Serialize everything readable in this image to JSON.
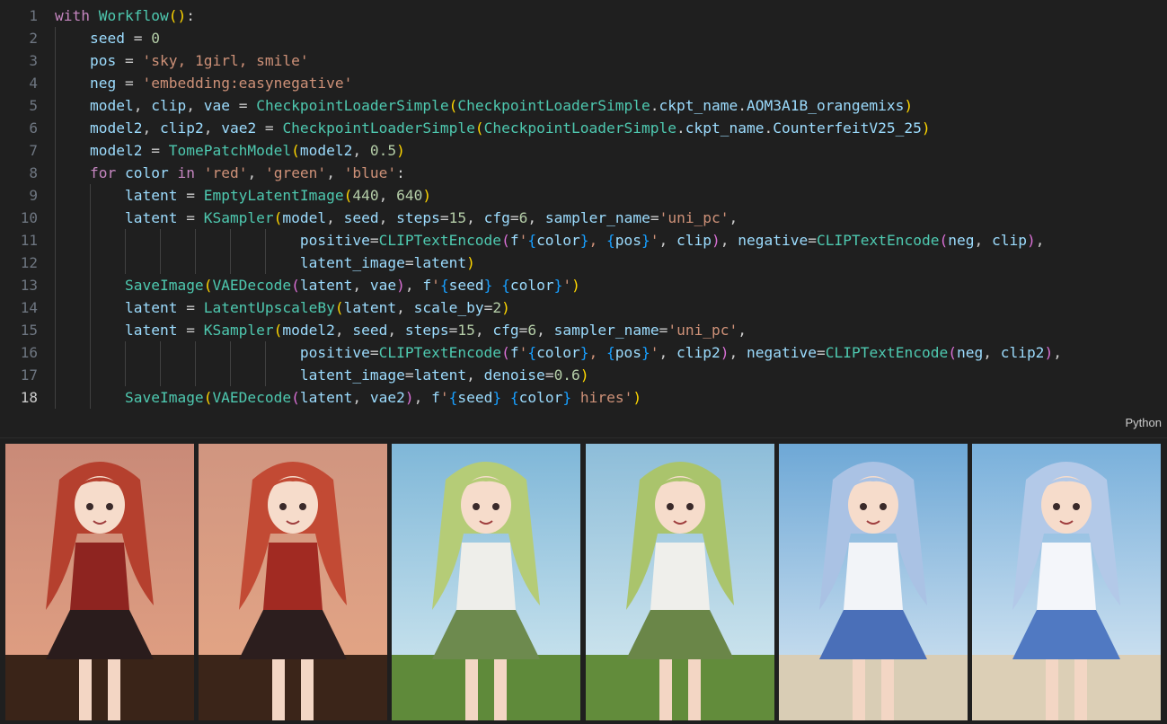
{
  "editor": {
    "language": "Python",
    "active_line": "18",
    "lines": [
      {
        "n": "1",
        "tokens": [
          [
            "k",
            "with"
          ],
          [
            "p",
            " "
          ],
          [
            "c",
            "Workflow"
          ],
          [
            "b1",
            "()"
          ],
          [
            "p",
            ":"
          ]
        ]
      },
      {
        "n": "2",
        "tokens": [
          [
            "p",
            "    "
          ],
          [
            "v",
            "seed"
          ],
          [
            "p",
            " = "
          ],
          [
            "n",
            "0"
          ]
        ]
      },
      {
        "n": "3",
        "tokens": [
          [
            "p",
            "    "
          ],
          [
            "v",
            "pos"
          ],
          [
            "p",
            " = "
          ],
          [
            "s",
            "'sky, 1girl, smile'"
          ]
        ]
      },
      {
        "n": "4",
        "tokens": [
          [
            "p",
            "    "
          ],
          [
            "v",
            "neg"
          ],
          [
            "p",
            " = "
          ],
          [
            "s",
            "'embedding:easynegative'"
          ]
        ]
      },
      {
        "n": "5",
        "tokens": [
          [
            "p",
            "    "
          ],
          [
            "v",
            "model"
          ],
          [
            "p",
            ", "
          ],
          [
            "v",
            "clip"
          ],
          [
            "p",
            ", "
          ],
          [
            "v",
            "vae"
          ],
          [
            "p",
            " = "
          ],
          [
            "c",
            "CheckpointLoaderSimple"
          ],
          [
            "b1",
            "("
          ],
          [
            "c",
            "CheckpointLoaderSimple"
          ],
          [
            "p",
            "."
          ],
          [
            "v",
            "ckpt_name"
          ],
          [
            "p",
            "."
          ],
          [
            "v",
            "AOM3A1B_orangemixs"
          ],
          [
            "b1",
            ")"
          ]
        ]
      },
      {
        "n": "6",
        "tokens": [
          [
            "p",
            "    "
          ],
          [
            "v",
            "model2"
          ],
          [
            "p",
            ", "
          ],
          [
            "v",
            "clip2"
          ],
          [
            "p",
            ", "
          ],
          [
            "v",
            "vae2"
          ],
          [
            "p",
            " = "
          ],
          [
            "c",
            "CheckpointLoaderSimple"
          ],
          [
            "b1",
            "("
          ],
          [
            "c",
            "CheckpointLoaderSimple"
          ],
          [
            "p",
            "."
          ],
          [
            "v",
            "ckpt_name"
          ],
          [
            "p",
            "."
          ],
          [
            "v",
            "CounterfeitV25_25"
          ],
          [
            "b1",
            ")"
          ]
        ]
      },
      {
        "n": "7",
        "tokens": [
          [
            "p",
            "    "
          ],
          [
            "v",
            "model2"
          ],
          [
            "p",
            " = "
          ],
          [
            "c",
            "TomePatchModel"
          ],
          [
            "b1",
            "("
          ],
          [
            "v",
            "model2"
          ],
          [
            "p",
            ", "
          ],
          [
            "n",
            "0.5"
          ],
          [
            "b1",
            ")"
          ]
        ]
      },
      {
        "n": "8",
        "tokens": [
          [
            "p",
            "    "
          ],
          [
            "k",
            "for"
          ],
          [
            "p",
            " "
          ],
          [
            "v",
            "color"
          ],
          [
            "p",
            " "
          ],
          [
            "k",
            "in"
          ],
          [
            "p",
            " "
          ],
          [
            "s",
            "'red'"
          ],
          [
            "p",
            ", "
          ],
          [
            "s",
            "'green'"
          ],
          [
            "p",
            ", "
          ],
          [
            "s",
            "'blue'"
          ],
          [
            "p",
            ":"
          ]
        ]
      },
      {
        "n": "9",
        "tokens": [
          [
            "p",
            "        "
          ],
          [
            "v",
            "latent"
          ],
          [
            "p",
            " = "
          ],
          [
            "c",
            "EmptyLatentImage"
          ],
          [
            "b1",
            "("
          ],
          [
            "n",
            "440"
          ],
          [
            "p",
            ", "
          ],
          [
            "n",
            "640"
          ],
          [
            "b1",
            ")"
          ]
        ]
      },
      {
        "n": "10",
        "tokens": [
          [
            "p",
            "        "
          ],
          [
            "v",
            "latent"
          ],
          [
            "p",
            " = "
          ],
          [
            "c",
            "KSampler"
          ],
          [
            "b1",
            "("
          ],
          [
            "v",
            "model"
          ],
          [
            "p",
            ", "
          ],
          [
            "v",
            "seed"
          ],
          [
            "p",
            ", "
          ],
          [
            "v",
            "steps"
          ],
          [
            "p",
            "="
          ],
          [
            "n",
            "15"
          ],
          [
            "p",
            ", "
          ],
          [
            "v",
            "cfg"
          ],
          [
            "p",
            "="
          ],
          [
            "n",
            "6"
          ],
          [
            "p",
            ", "
          ],
          [
            "v",
            "sampler_name"
          ],
          [
            "p",
            "="
          ],
          [
            "s",
            "'uni_pc'"
          ],
          [
            "p",
            ","
          ]
        ]
      },
      {
        "n": "11",
        "tokens": [
          [
            "p",
            "                            "
          ],
          [
            "v",
            "positive"
          ],
          [
            "p",
            "="
          ],
          [
            "c",
            "CLIPTextEncode"
          ],
          [
            "b2",
            "("
          ],
          [
            "v",
            "f"
          ],
          [
            "s",
            "'"
          ],
          [
            "b3",
            "{"
          ],
          [
            "v",
            "color"
          ],
          [
            "b3",
            "}"
          ],
          [
            "s",
            ", "
          ],
          [
            "b3",
            "{"
          ],
          [
            "v",
            "pos"
          ],
          [
            "b3",
            "}"
          ],
          [
            "s",
            "'"
          ],
          [
            "p",
            ", "
          ],
          [
            "v",
            "clip"
          ],
          [
            "b2",
            ")"
          ],
          [
            "p",
            ", "
          ],
          [
            "v",
            "negative"
          ],
          [
            "p",
            "="
          ],
          [
            "c",
            "CLIPTextEncode"
          ],
          [
            "b2",
            "("
          ],
          [
            "v",
            "neg"
          ],
          [
            "p",
            ", "
          ],
          [
            "v",
            "clip"
          ],
          [
            "b2",
            ")"
          ],
          [
            "p",
            ","
          ]
        ]
      },
      {
        "n": "12",
        "tokens": [
          [
            "p",
            "                            "
          ],
          [
            "v",
            "latent_image"
          ],
          [
            "p",
            "="
          ],
          [
            "v",
            "latent"
          ],
          [
            "b1",
            ")"
          ]
        ]
      },
      {
        "n": "13",
        "tokens": [
          [
            "p",
            "        "
          ],
          [
            "c",
            "SaveImage"
          ],
          [
            "b1",
            "("
          ],
          [
            "c",
            "VAEDecode"
          ],
          [
            "b2",
            "("
          ],
          [
            "v",
            "latent"
          ],
          [
            "p",
            ", "
          ],
          [
            "v",
            "vae"
          ],
          [
            "b2",
            ")"
          ],
          [
            "p",
            ", "
          ],
          [
            "v",
            "f"
          ],
          [
            "s",
            "'"
          ],
          [
            "b3",
            "{"
          ],
          [
            "v",
            "seed"
          ],
          [
            "b3",
            "}"
          ],
          [
            "s",
            " "
          ],
          [
            "b3",
            "{"
          ],
          [
            "v",
            "color"
          ],
          [
            "b3",
            "}"
          ],
          [
            "s",
            "'"
          ],
          [
            "b1",
            ")"
          ]
        ]
      },
      {
        "n": "14",
        "tokens": [
          [
            "p",
            "        "
          ],
          [
            "v",
            "latent"
          ],
          [
            "p",
            " = "
          ],
          [
            "c",
            "LatentUpscaleBy"
          ],
          [
            "b1",
            "("
          ],
          [
            "v",
            "latent"
          ],
          [
            "p",
            ", "
          ],
          [
            "v",
            "scale_by"
          ],
          [
            "p",
            "="
          ],
          [
            "n",
            "2"
          ],
          [
            "b1",
            ")"
          ]
        ]
      },
      {
        "n": "15",
        "tokens": [
          [
            "p",
            "        "
          ],
          [
            "v",
            "latent"
          ],
          [
            "p",
            " = "
          ],
          [
            "c",
            "KSampler"
          ],
          [
            "b1",
            "("
          ],
          [
            "v",
            "model2"
          ],
          [
            "p",
            ", "
          ],
          [
            "v",
            "seed"
          ],
          [
            "p",
            ", "
          ],
          [
            "v",
            "steps"
          ],
          [
            "p",
            "="
          ],
          [
            "n",
            "15"
          ],
          [
            "p",
            ", "
          ],
          [
            "v",
            "cfg"
          ],
          [
            "p",
            "="
          ],
          [
            "n",
            "6"
          ],
          [
            "p",
            ", "
          ],
          [
            "v",
            "sampler_name"
          ],
          [
            "p",
            "="
          ],
          [
            "s",
            "'uni_pc'"
          ],
          [
            "p",
            ","
          ]
        ]
      },
      {
        "n": "16",
        "tokens": [
          [
            "p",
            "                            "
          ],
          [
            "v",
            "positive"
          ],
          [
            "p",
            "="
          ],
          [
            "c",
            "CLIPTextEncode"
          ],
          [
            "b2",
            "("
          ],
          [
            "v",
            "f"
          ],
          [
            "s",
            "'"
          ],
          [
            "b3",
            "{"
          ],
          [
            "v",
            "color"
          ],
          [
            "b3",
            "}"
          ],
          [
            "s",
            ", "
          ],
          [
            "b3",
            "{"
          ],
          [
            "v",
            "pos"
          ],
          [
            "b3",
            "}"
          ],
          [
            "s",
            "'"
          ],
          [
            "p",
            ", "
          ],
          [
            "v",
            "clip2"
          ],
          [
            "b2",
            ")"
          ],
          [
            "p",
            ", "
          ],
          [
            "v",
            "negative"
          ],
          [
            "p",
            "="
          ],
          [
            "c",
            "CLIPTextEncode"
          ],
          [
            "b2",
            "("
          ],
          [
            "v",
            "neg"
          ],
          [
            "p",
            ", "
          ],
          [
            "v",
            "clip2"
          ],
          [
            "b2",
            ")"
          ],
          [
            "p",
            ","
          ]
        ]
      },
      {
        "n": "17",
        "tokens": [
          [
            "p",
            "                            "
          ],
          [
            "v",
            "latent_image"
          ],
          [
            "p",
            "="
          ],
          [
            "v",
            "latent"
          ],
          [
            "p",
            ", "
          ],
          [
            "v",
            "denoise"
          ],
          [
            "p",
            "="
          ],
          [
            "n",
            "0.6"
          ],
          [
            "b1",
            ")"
          ]
        ]
      },
      {
        "n": "18",
        "tokens": [
          [
            "p",
            "        "
          ],
          [
            "c",
            "SaveImage"
          ],
          [
            "b1",
            "("
          ],
          [
            "c",
            "VAEDecode"
          ],
          [
            "b2",
            "("
          ],
          [
            "v",
            "latent"
          ],
          [
            "p",
            ", "
          ],
          [
            "v",
            "vae2"
          ],
          [
            "b2",
            ")"
          ],
          [
            "p",
            ", "
          ],
          [
            "v",
            "f"
          ],
          [
            "s",
            "'"
          ],
          [
            "b3",
            "{"
          ],
          [
            "v",
            "seed"
          ],
          [
            "b3",
            "}"
          ],
          [
            "s",
            " "
          ],
          [
            "b3",
            "{"
          ],
          [
            "v",
            "color"
          ],
          [
            "b3",
            "}"
          ],
          [
            "s",
            " hires'"
          ],
          [
            "b1",
            ")"
          ]
        ]
      }
    ]
  },
  "gallery": {
    "images": [
      {
        "theme": "red",
        "sky_top": "#c98a78",
        "sky_bottom": "#e4a384",
        "hair": "#b5402e",
        "top": "#8e2420",
        "skirt": "#2a1c1c",
        "ground": "#3a2418"
      },
      {
        "theme": "red",
        "sky_top": "#d09580",
        "sky_bottom": "#e7a886",
        "hair": "#c24a34",
        "top": "#a12a22",
        "skirt": "#2c1e1e",
        "ground": "#3b2519"
      },
      {
        "theme": "green",
        "sky_top": "#7fb7d8",
        "sky_bottom": "#d8ecf2",
        "hair": "#b5cc77",
        "top": "#eeeeea",
        "skirt": "#6d8a4e",
        "ground": "#5f8a3a"
      },
      {
        "theme": "green",
        "sky_top": "#8dbdd9",
        "sky_bottom": "#dbedf2",
        "hair": "#aac46c",
        "top": "#efefeb",
        "skirt": "#6a8648",
        "ground": "#628c3b"
      },
      {
        "theme": "blue",
        "sky_top": "#6ea8d6",
        "sky_bottom": "#dbe9f4",
        "hair": "#aac2e4",
        "top": "#f2f4f8",
        "skirt": "#4a6fb8",
        "ground": "#d9cdb5"
      },
      {
        "theme": "blue",
        "sky_top": "#79b0db",
        "sky_bottom": "#e0ecf5",
        "hair": "#b3c9e8",
        "top": "#f4f6fa",
        "skirt": "#5079c2",
        "ground": "#dccfb6"
      }
    ]
  }
}
